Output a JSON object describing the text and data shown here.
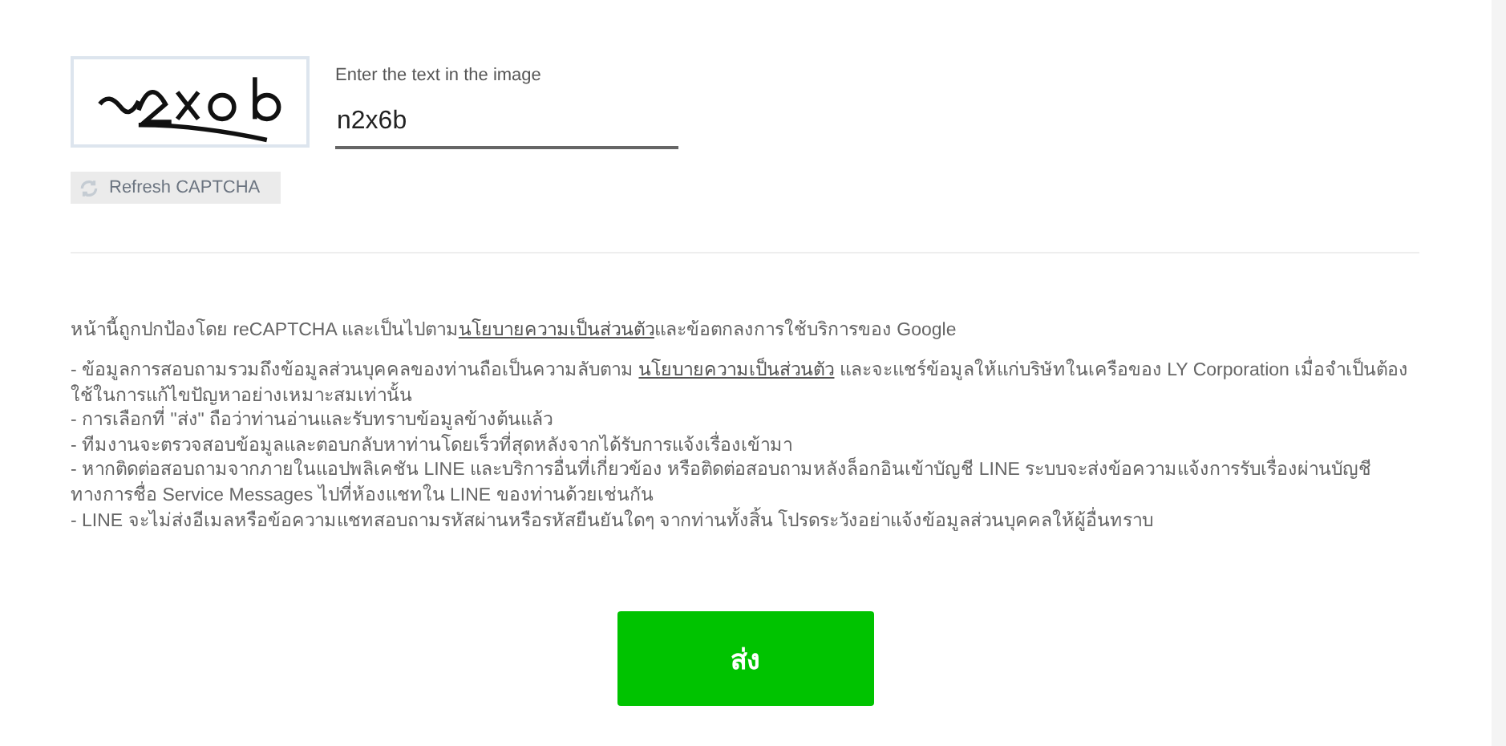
{
  "captcha": {
    "refresh_label": "Refresh CAPTCHA",
    "field_label": "Enter the text in the image",
    "value": "n2x6b"
  },
  "notice": [
    {
      "text": "หน้านี้ถูกปกป้องโดย reCAPTCHA และเป็นไปตาม"
    },
    {
      "link": "นโยบายความเป็นส่วนตัว"
    },
    {
      "text": "และข้อตกลงการใช้บริการของ Google"
    }
  ],
  "bullets": [
    [
      {
        "text": "- ข้อมูลการสอบถามรวมถึงข้อมูลส่วนบุคคลของท่านถือเป็นความลับตาม "
      },
      {
        "link": "นโยบายความเป็นส่วนตัว"
      },
      {
        "text": " และจะแชร์ข้อมูลให้แก่บริษัทในเครือของ LY Corporation เมื่อจำเป็นต้องใช้ในการแก้ไขปัญหาอย่างเหมาะสมเท่านั้น"
      }
    ],
    [
      {
        "text": "- การเลือกที่ \"ส่ง\" ถือว่าท่านอ่านและรับทราบข้อมูลข้างต้นแล้ว"
      }
    ],
    [
      {
        "text": "- ทีมงานจะตรวจสอบข้อมูลและตอบกลับหาท่านโดยเร็วที่สุดหลังจากได้รับการแจ้งเรื่องเข้ามา"
      }
    ],
    [
      {
        "text": "- หากติดต่อสอบถามจากภายในแอปพลิเคชัน LINE และบริการอื่นที่เกี่ยวข้อง หรือติดต่อสอบถามหลังล็อกอินเข้าบัญชี LINE ระบบจะส่งข้อความแจ้งการรับเรื่องผ่านบัญชีทางการชื่อ Service Messages ไปที่ห้องแชทใน LINE ของท่านด้วยเช่นกัน"
      }
    ],
    [
      {
        "text": "- LINE จะไม่ส่งอีเมลหรือข้อความแชทสอบถามรหัสผ่านหรือรหัสยืนยันใดๆ จากท่านทั้งสิ้น โปรดระวังอย่าแจ้งข้อมูลส่วนบุคคลให้ผู้อื่นทราบ"
      }
    ]
  ],
  "submit": "ส่ง"
}
